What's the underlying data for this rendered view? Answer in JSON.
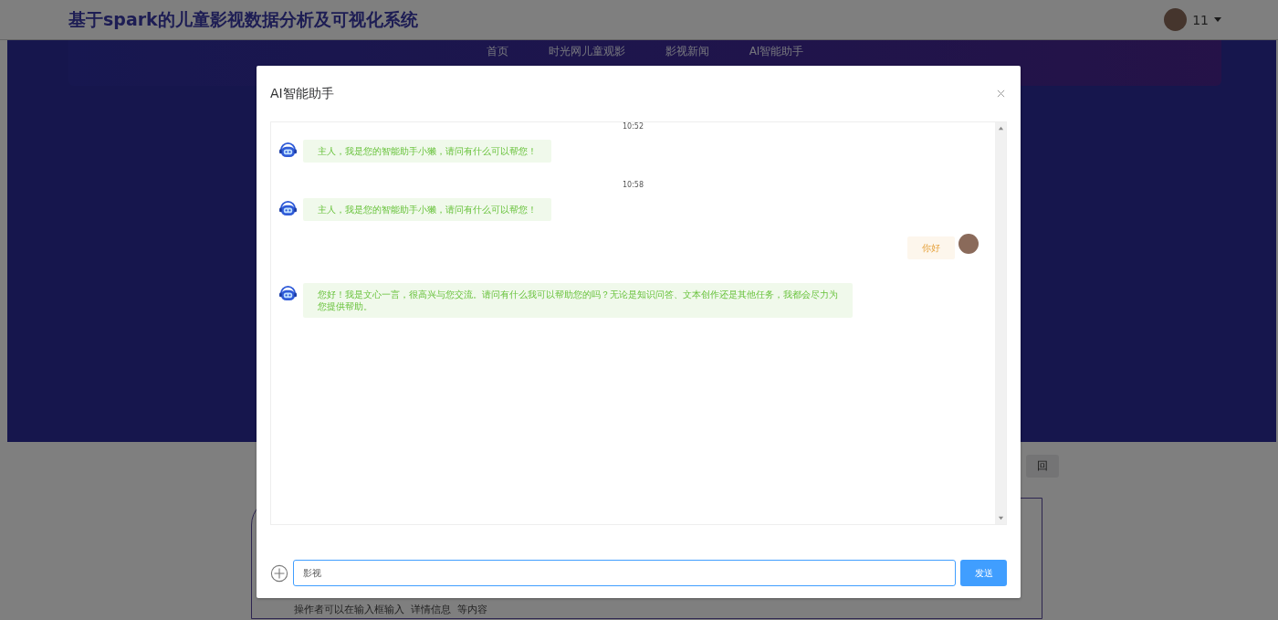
{
  "header": {
    "title": "基于spark的儿童影视数据分析及可视化系统",
    "user": {
      "name": "11"
    }
  },
  "nav": {
    "items": [
      {
        "label": "首页"
      },
      {
        "label": "时光网儿童观影"
      },
      {
        "label": "影视新闻"
      },
      {
        "label": "AI智能助手"
      }
    ]
  },
  "page": {
    "back_button": "回",
    "note": "操作者可以在输入框输入  详情信息  等内容"
  },
  "dialog": {
    "title": "AI智能助手",
    "messages": [
      {
        "kind": "time",
        "text": "10:52"
      },
      {
        "kind": "bot",
        "text": "主人，我是您的智能助手小獭，请问有什么可以帮您！"
      },
      {
        "kind": "time",
        "text": "10:58"
      },
      {
        "kind": "bot",
        "text": "主人，我是您的智能助手小獭，请问有什么可以帮您！"
      },
      {
        "kind": "user",
        "text": "你好"
      },
      {
        "kind": "bot",
        "text": "您好！我是文心一言，很高兴与您交流。请问有什么我可以帮助您的吗？无论是知识问答、文本创作还是其他任务，我都会尽力为您提供帮助。"
      }
    ],
    "input": {
      "value": "影视"
    },
    "send_button": "发送"
  }
}
